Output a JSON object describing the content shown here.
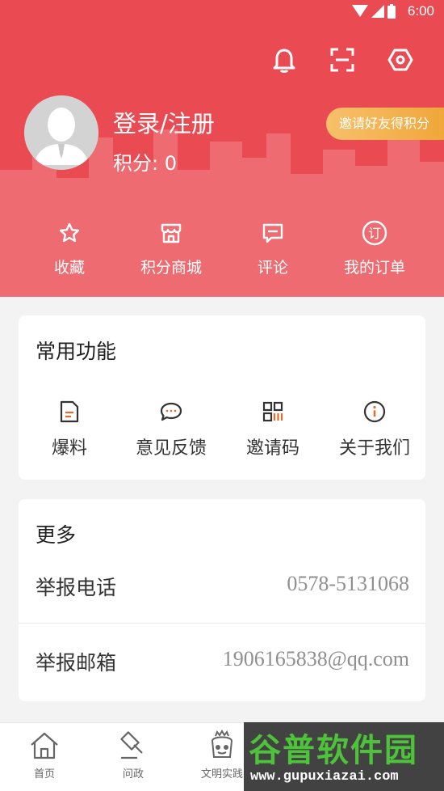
{
  "status_bar": {
    "time": "6:00"
  },
  "header": {
    "login_label": "登录/注册",
    "points_label": "积分: 0",
    "invite_label": "邀请好友得积分",
    "quick_items": [
      {
        "label": "收藏",
        "icon": "star-icon"
      },
      {
        "label": "积分商城",
        "icon": "store-icon"
      },
      {
        "label": "评论",
        "icon": "comment-icon"
      },
      {
        "label": "我的订单",
        "icon": "order-icon"
      }
    ],
    "top_icons": [
      "bell-icon",
      "scan-icon",
      "settings-icon"
    ]
  },
  "common": {
    "title": "常用功能",
    "items": [
      {
        "label": "爆料",
        "icon": "report-icon"
      },
      {
        "label": "意见反馈",
        "icon": "feedback-icon"
      },
      {
        "label": "邀请码",
        "icon": "qrcode-icon"
      },
      {
        "label": "关于我们",
        "icon": "info-icon"
      }
    ]
  },
  "more": {
    "title": "更多",
    "rows": [
      {
        "label": "举报电话",
        "value": "0578-5131068"
      },
      {
        "label": "举报邮箱",
        "value": "1906165838@qq.com"
      }
    ]
  },
  "bottom_nav": [
    {
      "label": "首页",
      "icon": "home-icon"
    },
    {
      "label": "问政",
      "icon": "gavel-icon"
    },
    {
      "label": "文明实践",
      "icon": "civilization-icon"
    }
  ],
  "watermark": {
    "title": "谷普软件园",
    "url": "www.gupuxiazai.com"
  },
  "colors": {
    "primary": "#ea4a52",
    "accent": "#f0a73a",
    "icon_orange": "#e86a2a"
  }
}
